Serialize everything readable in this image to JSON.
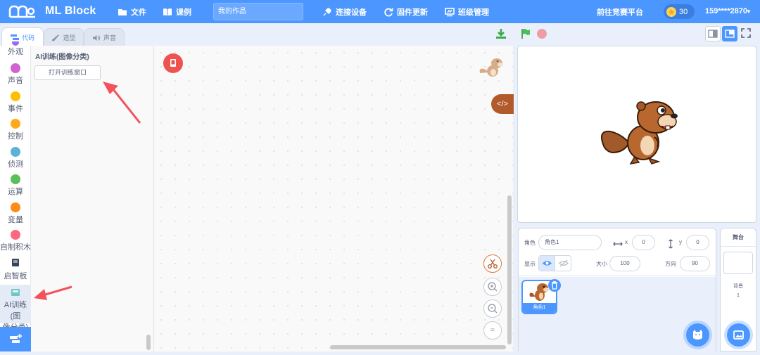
{
  "header": {
    "brand": "ML Block",
    "menu": {
      "file": "文件",
      "lessons": "课例",
      "connect": "连接设备",
      "firmware": "固件更新",
      "class": "班级管理"
    },
    "project_name": "我的作品",
    "competition": "前往竞赛平台",
    "stars": "30",
    "user": "159****2870"
  },
  "tabs": {
    "code": "代码",
    "costume": "造型",
    "sound": "声音"
  },
  "categories": [
    {
      "label": "外观",
      "color": "#9966ff"
    },
    {
      "label": "声音",
      "color": "#cf63cf"
    },
    {
      "label": "事件",
      "color": "#ffbf00"
    },
    {
      "label": "控制",
      "color": "#ffab19"
    },
    {
      "label": "侦测",
      "color": "#5cb1d6"
    },
    {
      "label": "运算",
      "color": "#59c059"
    },
    {
      "label": "变量",
      "color": "#ff8c1a"
    },
    {
      "label": "自制积木",
      "color": "#ff6680"
    },
    {
      "label": "启智板",
      "color": ""
    },
    {
      "label_line1": "AI训练(图",
      "label_line2": "像分类)",
      "color": ""
    }
  ],
  "flyout": {
    "title": "AI训练(图像分类)",
    "button": "打开训练窗口"
  },
  "workspace": {
    "code_toggle": "</>",
    "zoom_reset": "="
  },
  "sprite_info": {
    "sprite_label": "角色",
    "sprite_name": "角色1",
    "x_label": "x",
    "x_value": "0",
    "y_label": "y",
    "y_value": "0",
    "show_label": "显示",
    "size_label": "大小",
    "size_value": "100",
    "direction_label": "方向",
    "direction_value": "90"
  },
  "sprite_list": [
    {
      "name": "角色1"
    }
  ],
  "stage_panel": {
    "title": "舞台",
    "backdrop_label": "背景",
    "backdrop_count": "1"
  },
  "colors": {
    "primary": "#4c97ff",
    "annotation": "#f4525b"
  }
}
